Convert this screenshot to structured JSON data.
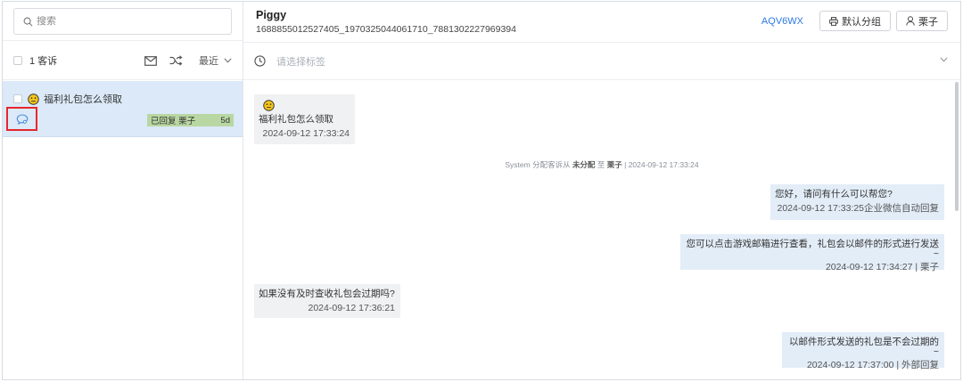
{
  "search": {
    "placeholder": "搜索"
  },
  "list_header": {
    "count_label": "1 客诉",
    "sort_label": "最近"
  },
  "ticket": {
    "subject": "福利礼包怎么领取",
    "status": "已回复 栗子",
    "age": "5d"
  },
  "player": {
    "name": "Piggy",
    "id": "1688855012527405_1970325044061710_7881302227969394"
  },
  "actions": {
    "ticket_code": "AQV6WX",
    "group_button": "默认分组",
    "assignee_button": "栗子"
  },
  "tags": {
    "placeholder": "请选择标签"
  },
  "messages": {
    "m1": {
      "text": "福利礼包怎么领取",
      "time": "2024-09-12 17:33:24"
    },
    "system": {
      "prefix": "System 分配客诉从",
      "from": "未分配",
      "mid": "至",
      "to": "栗子",
      "time": "| 2024-09-12 17:33:24"
    },
    "m2": {
      "text": "您好，请问有什么可以帮您?",
      "time": "2024-09-12 17:33:25企业微信自动回复"
    },
    "m3": {
      "text": "您可以点击游戏邮箱进行查看，礼包会以邮件的形式进行发送~",
      "time": "2024-09-12 17:34:27 | 栗子"
    },
    "m4": {
      "text": "如果没有及时查收礼包会过期吗?",
      "time": "2024-09-12 17:36:21"
    },
    "m5": {
      "text": "以邮件形式发送的礼包是不会过期的~",
      "time": "2024-09-12 17:37:00 | 外部回复"
    }
  },
  "colors": {
    "accent": "#2b78e4",
    "selected_row": "#dbe9f8",
    "status_replied": "#b9d7a2",
    "highlight_box": "#e8262d",
    "emoji_yellow": "#f5c518"
  },
  "icons": [
    "search-icon",
    "mail-icon",
    "shuffle-icon",
    "chevron-down-icon",
    "smiley-icon",
    "chat-bubble-icon",
    "clock-icon",
    "printer-icon",
    "user-icon"
  ]
}
